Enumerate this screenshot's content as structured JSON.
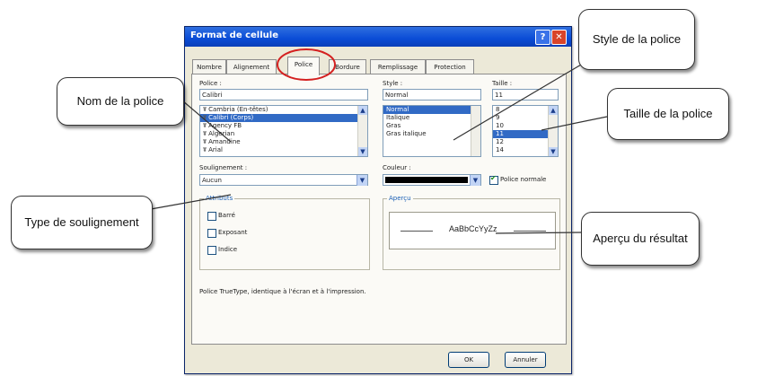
{
  "dialog": {
    "title": "Format de cellule",
    "help_icon": "help-icon",
    "close_icon": "close-icon",
    "tabs": [
      "Nombre",
      "Alignement",
      "Police",
      "Bordure",
      "Remplissage",
      "Protection"
    ],
    "active_tab": "Police"
  },
  "font": {
    "label": "Police :",
    "value": "Calibri",
    "items": [
      "Cambria (En-têtes)",
      "Calibri (Corps)",
      "Agency FB",
      "Algerian",
      "Amandine",
      "Arial"
    ],
    "selected_index": 1,
    "item_icon": "truetype-icon"
  },
  "style": {
    "label": "Style :",
    "value": "Normal",
    "items": [
      "Normal",
      "Italique",
      "Gras",
      "Gras italique"
    ],
    "selected_index": 0
  },
  "size": {
    "label": "Taille :",
    "value": "11",
    "items": [
      "8",
      "9",
      "10",
      "11",
      "12",
      "14"
    ],
    "selected_index": 3
  },
  "underline": {
    "label": "Soulignement :",
    "value": "Aucun"
  },
  "color": {
    "label": "Couleur :",
    "swatch": "#000000",
    "normal_font_label": "Police normale",
    "normal_font_checked": true
  },
  "attributes": {
    "title": "Attributs",
    "items": [
      {
        "label": "Barré",
        "checked": false
      },
      {
        "label": "Exposant",
        "checked": false
      },
      {
        "label": "Indice",
        "checked": false
      }
    ]
  },
  "preview": {
    "title": "Aperçu",
    "sample": "AaBbCcYyZz"
  },
  "info_text": "Police TrueType, identique à l'écran et à l'impression.",
  "buttons": {
    "ok": "OK",
    "cancel": "Annuler"
  },
  "callouts": {
    "font_name": "Nom de la police",
    "font_style": "Style de la police",
    "font_size": "Taille de la police",
    "underline_type": "Type de soulignement",
    "preview_result": "Aperçu du résultat"
  },
  "colors": {
    "title_bar": "#0a4cd6",
    "selection": "#316ac5",
    "active_tab_highlight": "#d42020",
    "dialog_bg": "#ece9d8"
  }
}
